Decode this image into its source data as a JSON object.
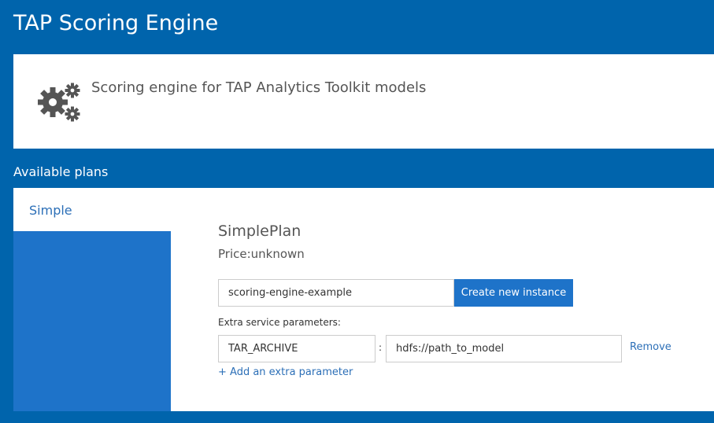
{
  "header": {
    "title": "TAP Scoring Engine"
  },
  "description": {
    "icon": "gears-icon",
    "text": "Scoring engine for TAP Analytics Toolkit models"
  },
  "plans": {
    "heading": "Available plans",
    "tabs": [
      {
        "label": "Simple",
        "selected": true
      }
    ],
    "selected_plan": {
      "name": "SimplePlan",
      "price": "Price:unknown",
      "instance_name_value": "scoring-engine-example",
      "create_button_label": "Create new instance",
      "extra_params_label": "Extra service parameters:",
      "params": [
        {
          "key": "TAR_ARCHIVE",
          "separator": ":",
          "value": "hdfs://path_to_model",
          "remove_label": "Remove"
        }
      ],
      "add_param_label": "+ Add an extra parameter"
    }
  },
  "colors": {
    "background": "#0064ac",
    "accent": "#1e73c9",
    "link": "#2c6fb7"
  }
}
